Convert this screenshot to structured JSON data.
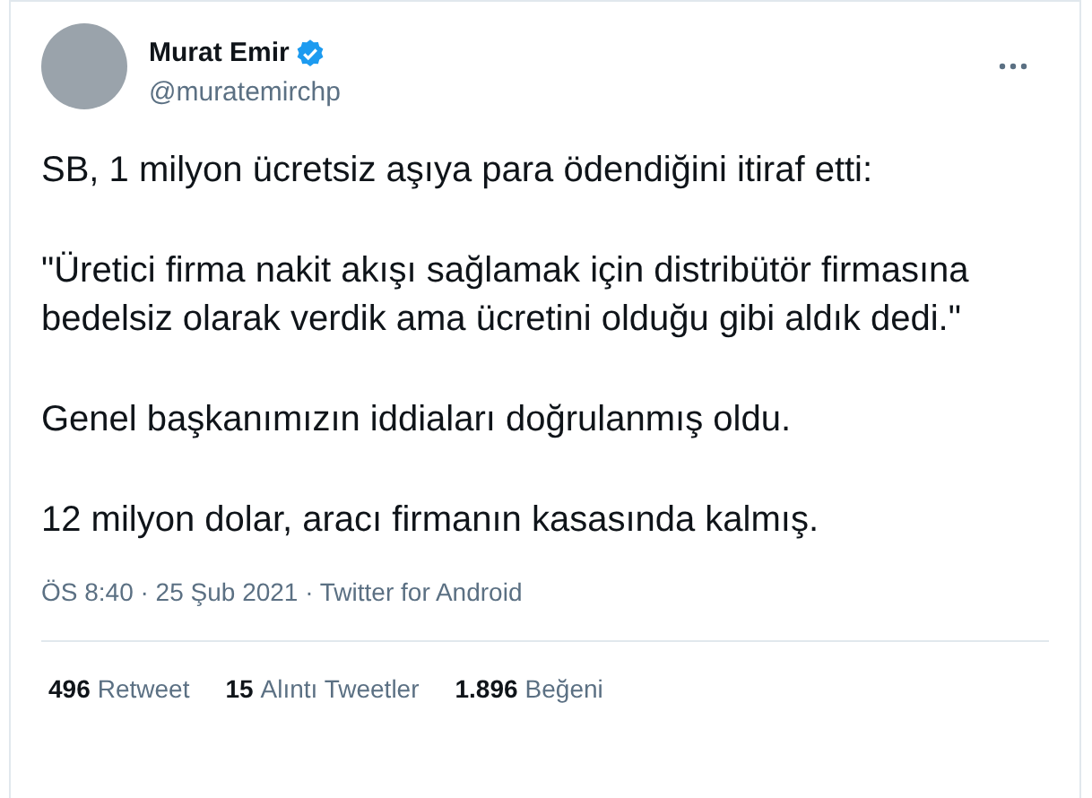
{
  "author": {
    "name": "Murat Emir",
    "verified": true,
    "handle": "@muratemirchp"
  },
  "paragraphs": [
    "SB, 1 milyon ücretsiz aşıya para ödendiğini itiraf etti:",
    "\"Üretici firma nakit akışı sağlamak için distribütör firmasına bedelsiz olarak verdik ama ücretini olduğu gibi aldık dedi.\"",
    "Genel başkanımızın iddiaları doğrulanmış oldu.",
    "12 milyon dolar, aracı firmanın kasasında kalmış."
  ],
  "meta": "ÖS 8:40 · 25 Şub 2021 · Twitter for Android",
  "stats": [
    {
      "count": "496",
      "label": "Retweet"
    },
    {
      "count": "15",
      "label": "Alıntı Tweetler"
    },
    {
      "count": "1.896",
      "label": "Beğeni"
    }
  ]
}
